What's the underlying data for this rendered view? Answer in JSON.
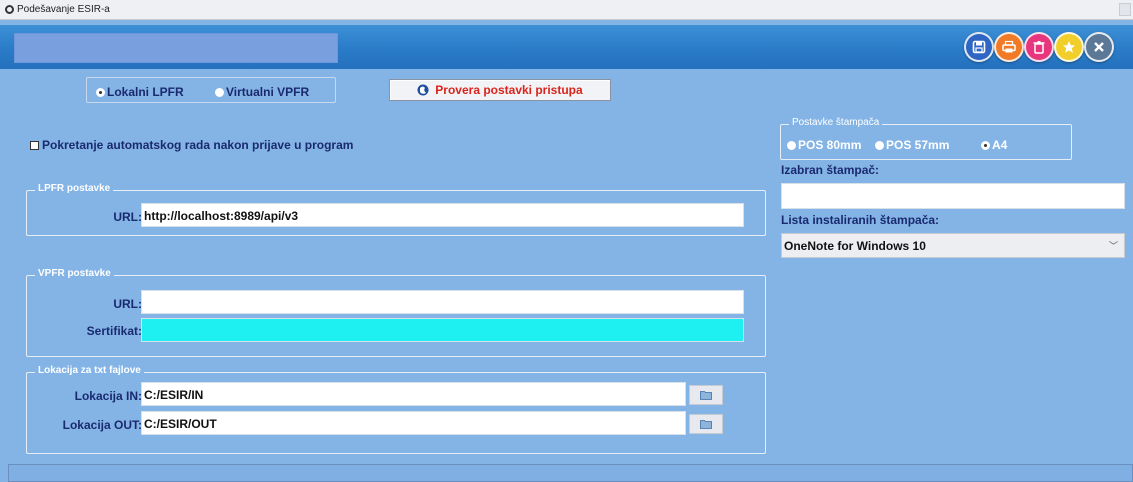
{
  "window": {
    "title": "Podešavanje ESIR-a"
  },
  "toolbar": {
    "buttons": [
      "save",
      "print",
      "delete",
      "favorite",
      "close"
    ]
  },
  "mode": {
    "options": [
      "Lokalni LPFR",
      "Virtualni VPFR"
    ],
    "selected": "Lokalni LPFR"
  },
  "check_button_label": "Provera postavki pristupa",
  "autostart_label": "Pokretanje automatskog rada nakon prijave u program",
  "lpfr": {
    "title": "LPFR postavke",
    "url_label": "URL:",
    "url_value": "http://localhost:8989/api/v3"
  },
  "vpfr": {
    "title": "VPFR postavke",
    "url_label": "URL:",
    "url_value": "",
    "cert_label": "Sertifikat:",
    "cert_value": ""
  },
  "txt": {
    "title": "Lokacija za txt fajlove",
    "in_label": "Lokacija IN:",
    "in_value": "C:/ESIR/IN",
    "out_label": "Lokacija OUT:",
    "out_value": "C:/ESIR/OUT"
  },
  "printer": {
    "title": "Postavke štampača",
    "options": [
      "POS 80mm",
      "POS 57mm",
      "A4"
    ],
    "selected": "A4",
    "selected_label": "Izabran štampač:",
    "selected_value": "",
    "list_label": "Lista instaliranih štampača:",
    "list_value": "OneNote for Windows 10"
  },
  "colors": {
    "background": "#84b4e6",
    "banner": "#2a7cc8",
    "cert_field": "#1ef0f2",
    "check_button_text": "#d8241c"
  }
}
